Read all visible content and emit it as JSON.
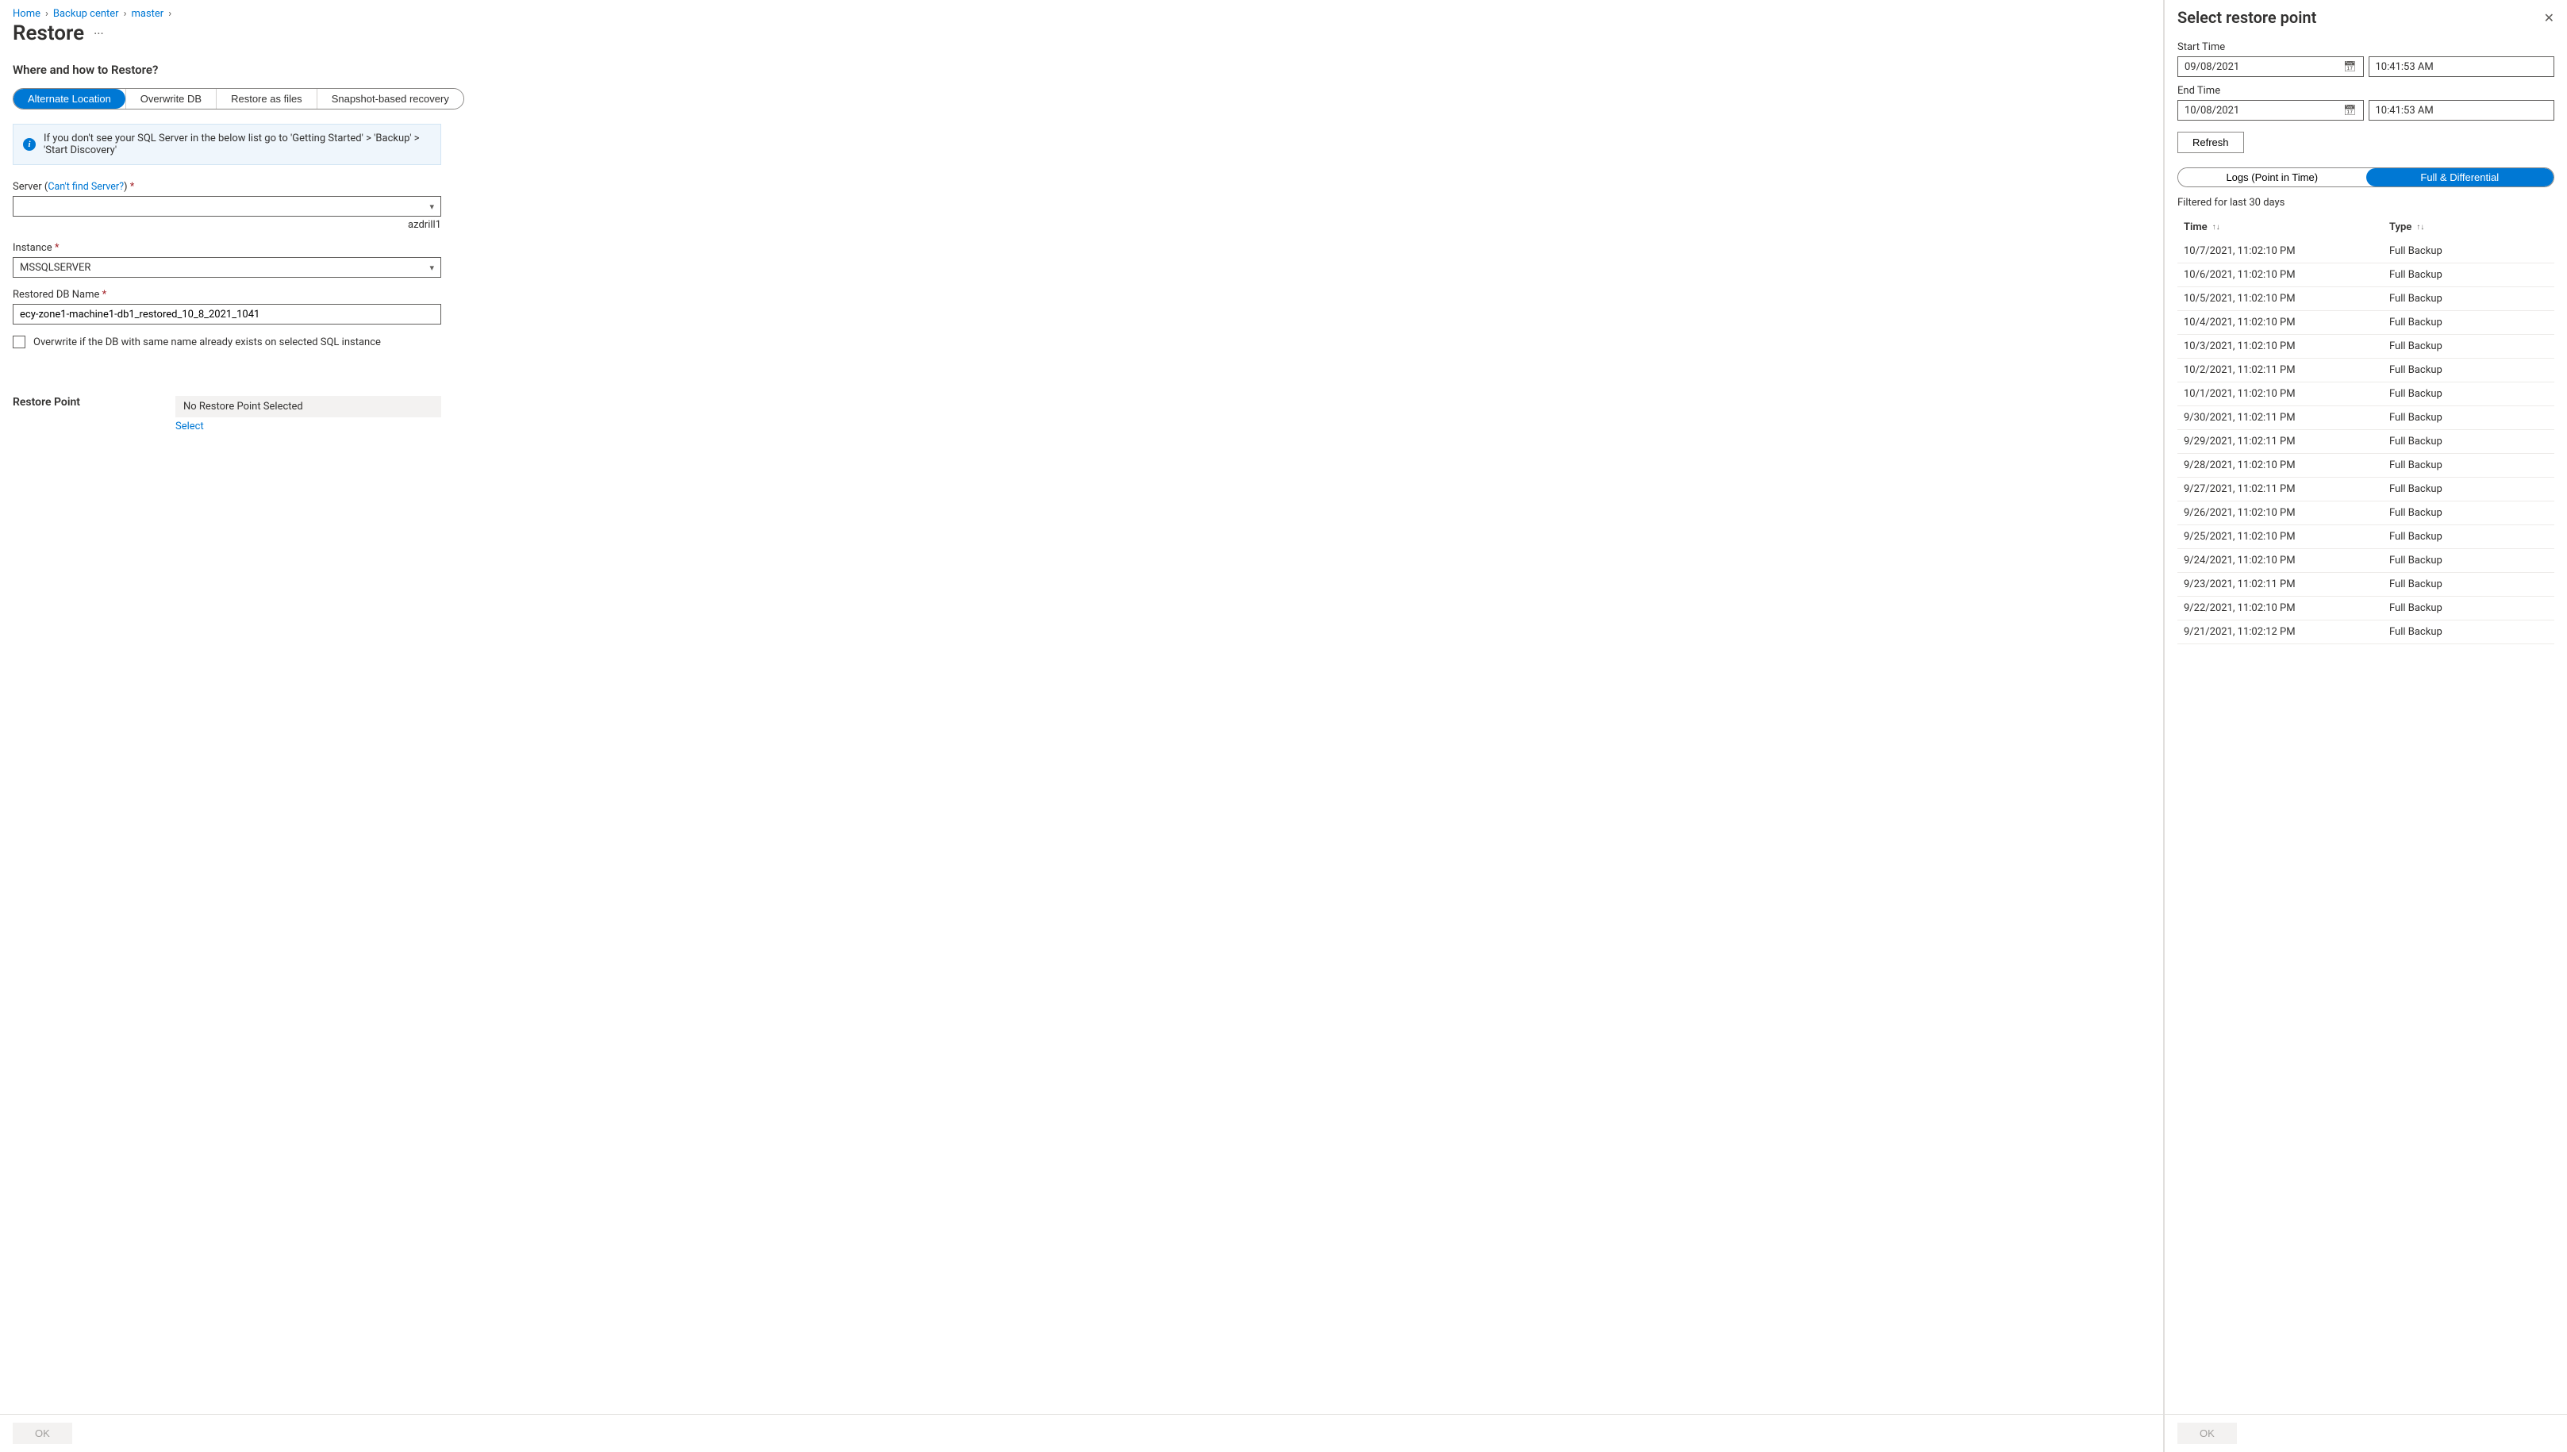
{
  "breadcrumb": {
    "items": [
      "Home",
      "Backup center",
      "master"
    ]
  },
  "page": {
    "title": "Restore",
    "section_heading": "Where and how to Restore?",
    "tabs": [
      {
        "label": "Alternate Location",
        "active": true
      },
      {
        "label": "Overwrite DB",
        "active": false
      },
      {
        "label": "Restore as files",
        "active": false
      },
      {
        "label": "Snapshot-based recovery",
        "active": false
      }
    ],
    "info": "If you don't see your SQL Server in the below list go to 'Getting Started' > 'Backup' > 'Start Discovery'"
  },
  "fields": {
    "server_label": "Server (",
    "server_link": "Can't find Server?",
    "server_label_close": ")",
    "server_value": "",
    "server_hint": "azdrill1",
    "instance_label": "Instance",
    "instance_value": "MSSQLSERVER",
    "dbname_label": "Restored DB Name",
    "dbname_value": "ecy-zone1-machine1-db1_restored_10_8_2021_1041",
    "overwrite_label": "Overwrite if the DB with same name already exists on selected SQL instance"
  },
  "restore_point": {
    "heading": "Restore Point",
    "no_selection": "No Restore Point Selected",
    "select_link": "Select"
  },
  "footer": {
    "ok": "OK"
  },
  "side": {
    "title": "Select restore point",
    "start_time_label": "Start Time",
    "start_date": "09/08/2021",
    "start_time": "10:41:53 AM",
    "end_time_label": "End Time",
    "end_date": "10/08/2021",
    "end_time": "10:41:53 AM",
    "refresh": "Refresh",
    "tabs": [
      {
        "label": "Logs (Point in Time)",
        "active": false
      },
      {
        "label": "Full & Differential",
        "active": true
      }
    ],
    "filter_text": "Filtered for last 30 days",
    "columns": {
      "time": "Time",
      "type": "Type"
    },
    "rows": [
      {
        "time": "10/7/2021, 11:02:10 PM",
        "type": "Full Backup"
      },
      {
        "time": "10/6/2021, 11:02:10 PM",
        "type": "Full Backup"
      },
      {
        "time": "10/5/2021, 11:02:10 PM",
        "type": "Full Backup"
      },
      {
        "time": "10/4/2021, 11:02:10 PM",
        "type": "Full Backup"
      },
      {
        "time": "10/3/2021, 11:02:10 PM",
        "type": "Full Backup"
      },
      {
        "time": "10/2/2021, 11:02:11 PM",
        "type": "Full Backup"
      },
      {
        "time": "10/1/2021, 11:02:10 PM",
        "type": "Full Backup"
      },
      {
        "time": "9/30/2021, 11:02:11 PM",
        "type": "Full Backup"
      },
      {
        "time": "9/29/2021, 11:02:11 PM",
        "type": "Full Backup"
      },
      {
        "time": "9/28/2021, 11:02:10 PM",
        "type": "Full Backup"
      },
      {
        "time": "9/27/2021, 11:02:11 PM",
        "type": "Full Backup"
      },
      {
        "time": "9/26/2021, 11:02:10 PM",
        "type": "Full Backup"
      },
      {
        "time": "9/25/2021, 11:02:10 PM",
        "type": "Full Backup"
      },
      {
        "time": "9/24/2021, 11:02:10 PM",
        "type": "Full Backup"
      },
      {
        "time": "9/23/2021, 11:02:11 PM",
        "type": "Full Backup"
      },
      {
        "time": "9/22/2021, 11:02:10 PM",
        "type": "Full Backup"
      },
      {
        "time": "9/21/2021, 11:02:12 PM",
        "type": "Full Backup"
      }
    ],
    "ok": "OK"
  }
}
